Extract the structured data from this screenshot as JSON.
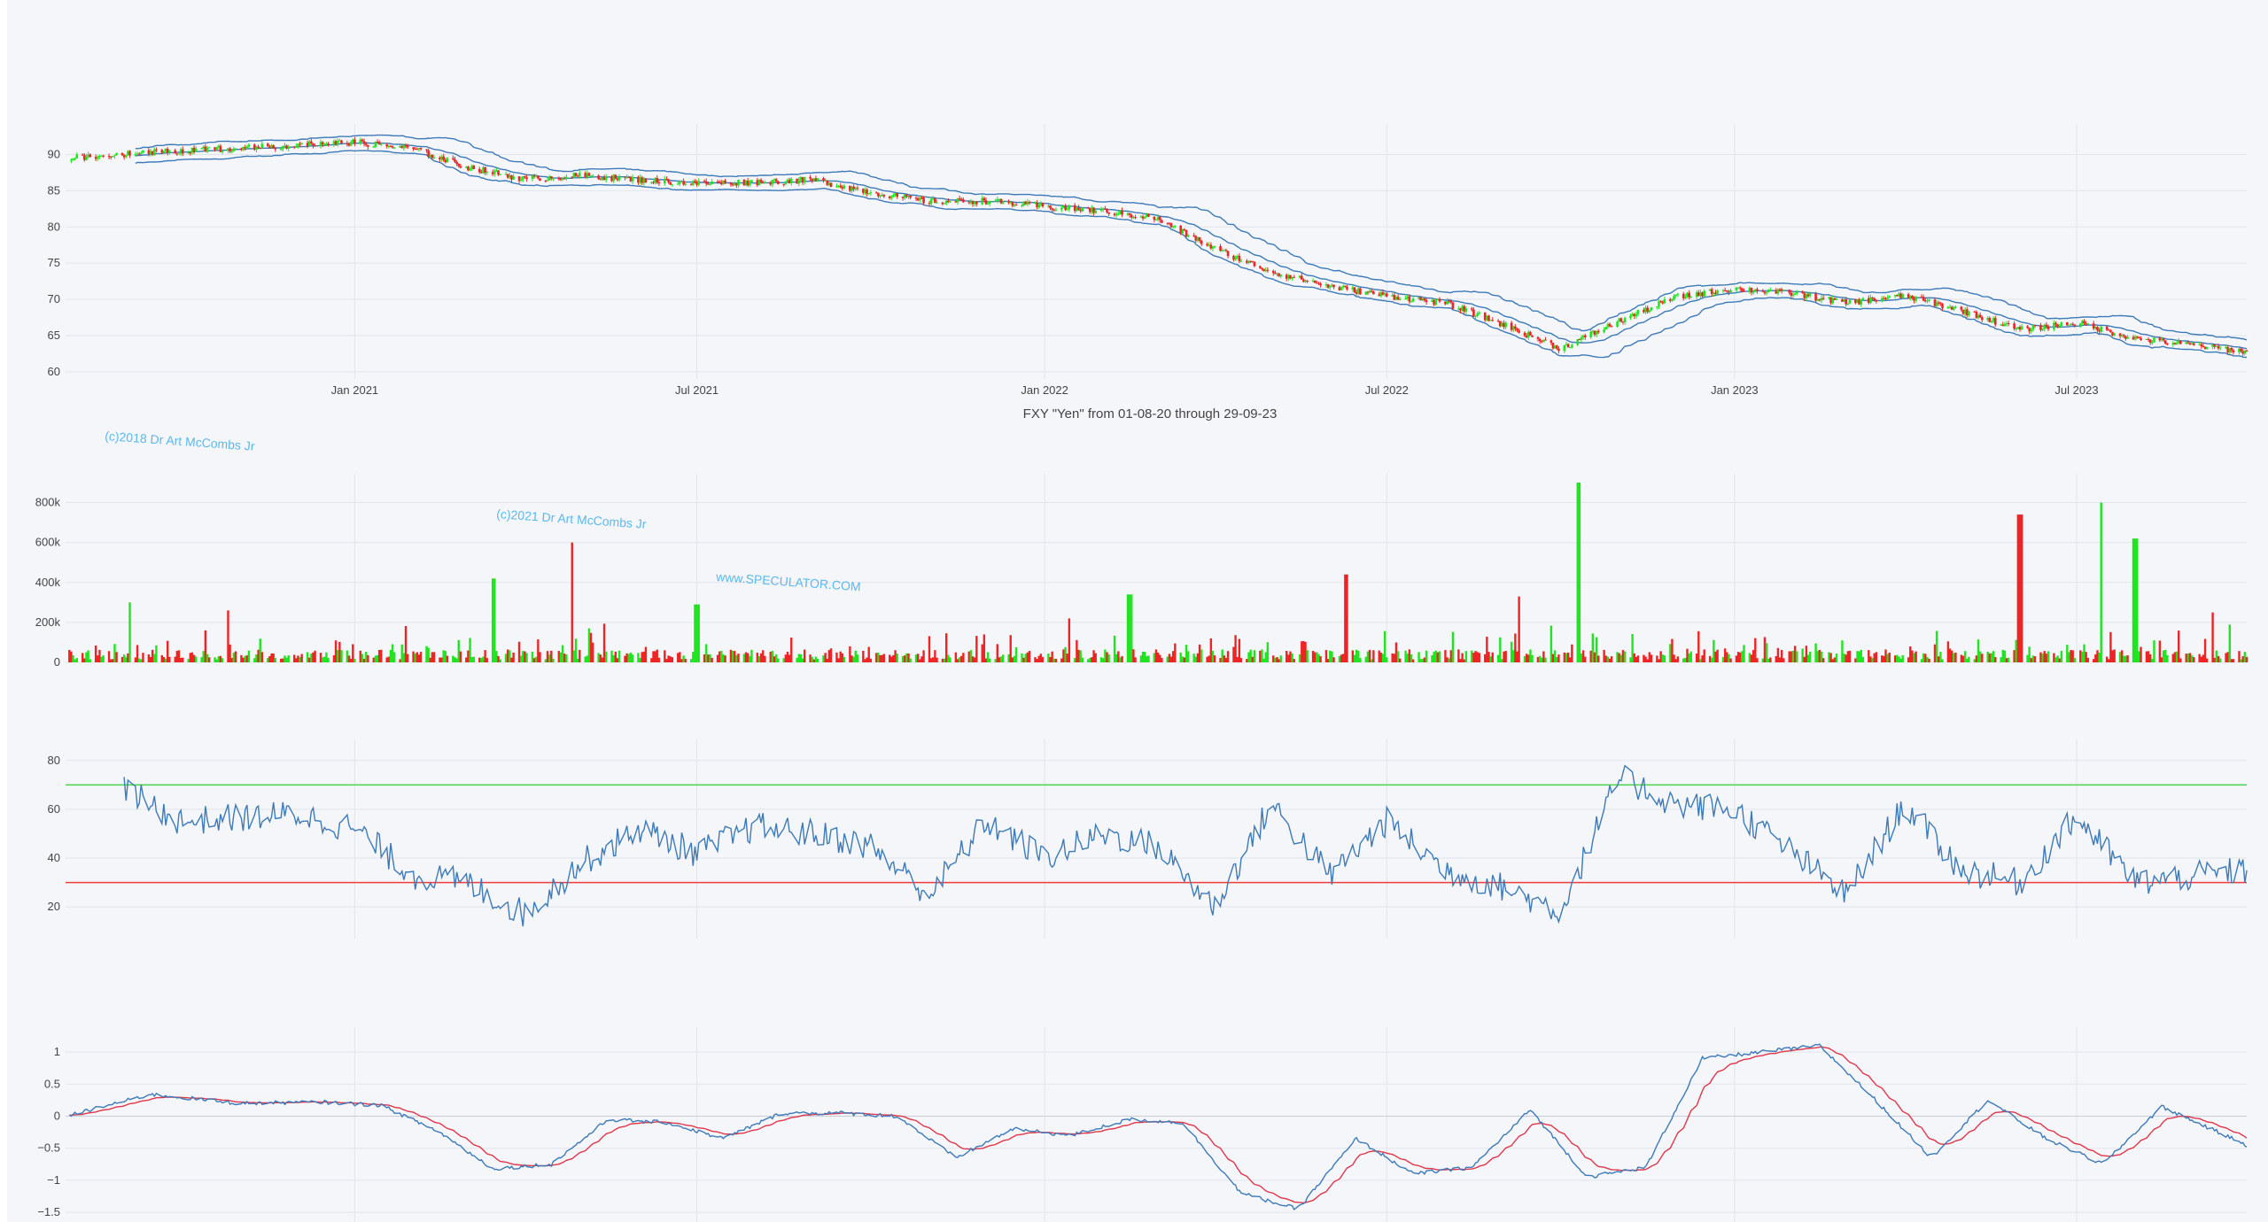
{
  "colors": {
    "background": "#f4f6fa",
    "grid": "#e1e5ec",
    "up": "#21e421",
    "down": "#ee2424",
    "line": "#3d7ab7",
    "signal": "#e0364a",
    "upper_threshold": "#4ad34a",
    "lower_threshold": "#ee3b3b",
    "watermark": "#5cb8ec"
  },
  "watermarks": [
    "(c)2018 Dr Art McCombs Jr",
    "(c)2021 Dr Art McCombs Jr",
    "www.SPECULATOR.COM"
  ],
  "chart_data": [
    {
      "type": "candlestick",
      "title": "FXY \"Yen\" from 01-08-20 through 29-09-23",
      "x_ticks": [
        "Jan 2021",
        "Jul 2021",
        "Jan 2022",
        "Jul 2022",
        "Jan 2023",
        "Jul 2023"
      ],
      "x_range": [
        "2020-08-01",
        "2023-09-29"
      ],
      "y_ticks": [
        "60",
        "65",
        "70",
        "75",
        "80",
        "85",
        "90"
      ],
      "ylim": [
        59,
        93
      ],
      "overlays": [
        "moving average",
        "upper band",
        "lower band"
      ],
      "close_path": [
        [
          "2020-08-01",
          89.5
        ],
        [
          "2020-10-01",
          90.5
        ],
        [
          "2020-12-01",
          91.3
        ],
        [
          "2021-01-01",
          91.7
        ],
        [
          "2021-02-01",
          90.8
        ],
        [
          "2021-03-01",
          88.3
        ],
        [
          "2021-04-01",
          86.6
        ],
        [
          "2021-05-01",
          87.1
        ],
        [
          "2021-06-01",
          86.5
        ],
        [
          "2021-07-01",
          86.0
        ],
        [
          "2021-08-01",
          86.2
        ],
        [
          "2021-09-01",
          86.5
        ],
        [
          "2021-10-01",
          84.8
        ],
        [
          "2021-11-01",
          83.5
        ],
        [
          "2021-12-01",
          83.6
        ],
        [
          "2022-01-01",
          82.8
        ],
        [
          "2022-02-01",
          82.2
        ],
        [
          "2022-03-01",
          81.2
        ],
        [
          "2022-04-01",
          77.0
        ],
        [
          "2022-05-01",
          73.8
        ],
        [
          "2022-06-01",
          71.8
        ],
        [
          "2022-07-01",
          70.5
        ],
        [
          "2022-08-01",
          69.5
        ],
        [
          "2022-09-01",
          66.5
        ],
        [
          "2022-10-01",
          63.2
        ],
        [
          "2022-11-01",
          67.0
        ],
        [
          "2022-12-01",
          70.3
        ],
        [
          "2023-01-01",
          71.5
        ],
        [
          "2023-02-01",
          70.8
        ],
        [
          "2023-03-01",
          69.5
        ],
        [
          "2023-04-01",
          70.5
        ],
        [
          "2023-05-01",
          68.5
        ],
        [
          "2023-06-01",
          65.8
        ],
        [
          "2023-07-01",
          66.8
        ],
        [
          "2023-08-01",
          64.6
        ],
        [
          "2023-09-29",
          62.8
        ]
      ]
    },
    {
      "type": "bar",
      "title": "",
      "y_ticks": [
        "0",
        "200k",
        "400k",
        "600k",
        "800k"
      ],
      "ylim": [
        0,
        900000
      ],
      "spikes": [
        [
          "2020-09-05",
          300000,
          "up"
        ],
        [
          "2020-10-25",
          260000,
          "down"
        ],
        [
          "2021-03-15",
          420000,
          "up"
        ],
        [
          "2021-04-25",
          600000,
          "down"
        ],
        [
          "2021-07-01",
          290000,
          "up"
        ],
        [
          "2022-01-15",
          220000,
          "down"
        ],
        [
          "2022-02-15",
          340000,
          "up"
        ],
        [
          "2022-06-10",
          440000,
          "down"
        ],
        [
          "2022-09-10",
          330000,
          "down"
        ],
        [
          "2022-10-10",
          900000,
          "up"
        ],
        [
          "2023-06-01",
          740000,
          "down"
        ],
        [
          "2023-07-15",
          800000,
          "up"
        ],
        [
          "2023-08-01",
          620000,
          "up"
        ],
        [
          "2023-09-10",
          250000,
          "down"
        ]
      ]
    },
    {
      "type": "line",
      "title": "",
      "y_ticks": [
        "20",
        "40",
        "60",
        "80"
      ],
      "ylim": [
        7,
        85
      ],
      "thresholds": [
        70,
        30
      ],
      "series_path": [
        [
          "2020-09-01",
          68
        ],
        [
          "2020-10-01",
          55
        ],
        [
          "2020-12-01",
          58
        ],
        [
          "2021-01-01",
          52
        ],
        [
          "2021-02-01",
          33
        ],
        [
          "2021-03-01",
          30
        ],
        [
          "2021-04-01",
          17
        ],
        [
          "2021-05-01",
          38
        ],
        [
          "2021-06-01",
          52
        ],
        [
          "2021-07-01",
          42
        ],
        [
          "2021-08-01",
          53
        ],
        [
          "2021-09-01",
          50
        ],
        [
          "2021-10-01",
          45
        ],
        [
          "2021-11-01",
          25
        ],
        [
          "2021-12-01",
          55
        ],
        [
          "2022-01-01",
          40
        ],
        [
          "2022-02-01",
          50
        ],
        [
          "2022-03-01",
          45
        ],
        [
          "2022-04-01",
          20
        ],
        [
          "2022-05-01",
          62
        ],
        [
          "2022-06-01",
          33
        ],
        [
          "2022-07-01",
          55
        ],
        [
          "2022-08-01",
          35
        ],
        [
          "2022-09-01",
          28
        ],
        [
          "2022-10-01",
          18
        ],
        [
          "2022-11-01",
          73
        ],
        [
          "2022-12-01",
          62
        ],
        [
          "2023-01-01",
          60
        ],
        [
          "2023-02-01",
          42
        ],
        [
          "2023-03-01",
          25
        ],
        [
          "2023-04-01",
          62
        ],
        [
          "2023-05-01",
          35
        ],
        [
          "2023-06-01",
          30
        ],
        [
          "2023-07-01",
          57
        ],
        [
          "2023-08-01",
          30
        ],
        [
          "2023-09-29",
          35
        ]
      ]
    },
    {
      "type": "line",
      "title": "",
      "y_ticks": [
        "−1.5",
        "−1",
        "−0.5",
        "0",
        "0.5",
        "1"
      ],
      "ylim": [
        -1.65,
        1.25
      ],
      "series_path": [
        [
          "2020-08-01",
          0
        ],
        [
          "2020-09-15",
          0.34
        ],
        [
          "2020-11-01",
          0.2
        ],
        [
          "2020-12-15",
          0.22
        ],
        [
          "2021-01-15",
          0.17
        ],
        [
          "2021-02-15",
          -0.25
        ],
        [
          "2021-03-15",
          -0.82
        ],
        [
          "2021-04-15",
          -0.75
        ],
        [
          "2021-05-15",
          -0.05
        ],
        [
          "2021-06-15",
          -0.1
        ],
        [
          "2021-07-15",
          -0.35
        ],
        [
          "2021-08-15",
          0.05
        ],
        [
          "2021-09-15",
          0.05
        ],
        [
          "2021-10-15",
          0.0
        ],
        [
          "2021-11-15",
          -0.65
        ],
        [
          "2021-12-15",
          -0.2
        ],
        [
          "2022-01-15",
          -0.3
        ],
        [
          "2022-02-15",
          -0.05
        ],
        [
          "2022-03-15",
          -0.1
        ],
        [
          "2022-04-15",
          -1.2
        ],
        [
          "2022-05-15",
          -1.45
        ],
        [
          "2022-06-15",
          -0.35
        ],
        [
          "2022-07-15",
          -0.9
        ],
        [
          "2022-08-15",
          -0.8
        ],
        [
          "2022-09-15",
          0.1
        ],
        [
          "2022-10-15",
          -0.95
        ],
        [
          "2022-11-15",
          -0.8
        ],
        [
          "2022-12-15",
          0.9
        ],
        [
          "2023-01-15",
          1.0
        ],
        [
          "2023-02-15",
          1.1
        ],
        [
          "2023-03-15",
          0.3
        ],
        [
          "2023-04-15",
          -0.65
        ],
        [
          "2023-05-15",
          0.25
        ],
        [
          "2023-06-15",
          -0.35
        ],
        [
          "2023-07-15",
          -0.75
        ],
        [
          "2023-08-15",
          0.15
        ],
        [
          "2023-09-29",
          -0.45
        ]
      ]
    }
  ]
}
